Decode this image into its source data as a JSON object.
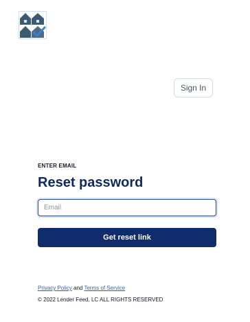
{
  "header": {
    "logo_icon": "house-checkmark-logo-icon",
    "signin_label": "Sign In"
  },
  "form": {
    "eyebrow": "ENTER EMAIL",
    "title": "Reset password",
    "email_placeholder": "Email",
    "email_value": "",
    "submit_label": "Get reset link"
  },
  "footer": {
    "privacy_label": "Privacy Policy",
    "and_text": "and",
    "terms_label": "Terms of Service",
    "copyright": "© 2022 Lender Feed, LC ALL RIGHTS RESERVED"
  },
  "colors": {
    "primary": "#112c6b",
    "title": "#0f2a5c",
    "link": "#3b5f99",
    "logo_dark": "#3d5a73",
    "logo_accent": "#3b82c4"
  }
}
